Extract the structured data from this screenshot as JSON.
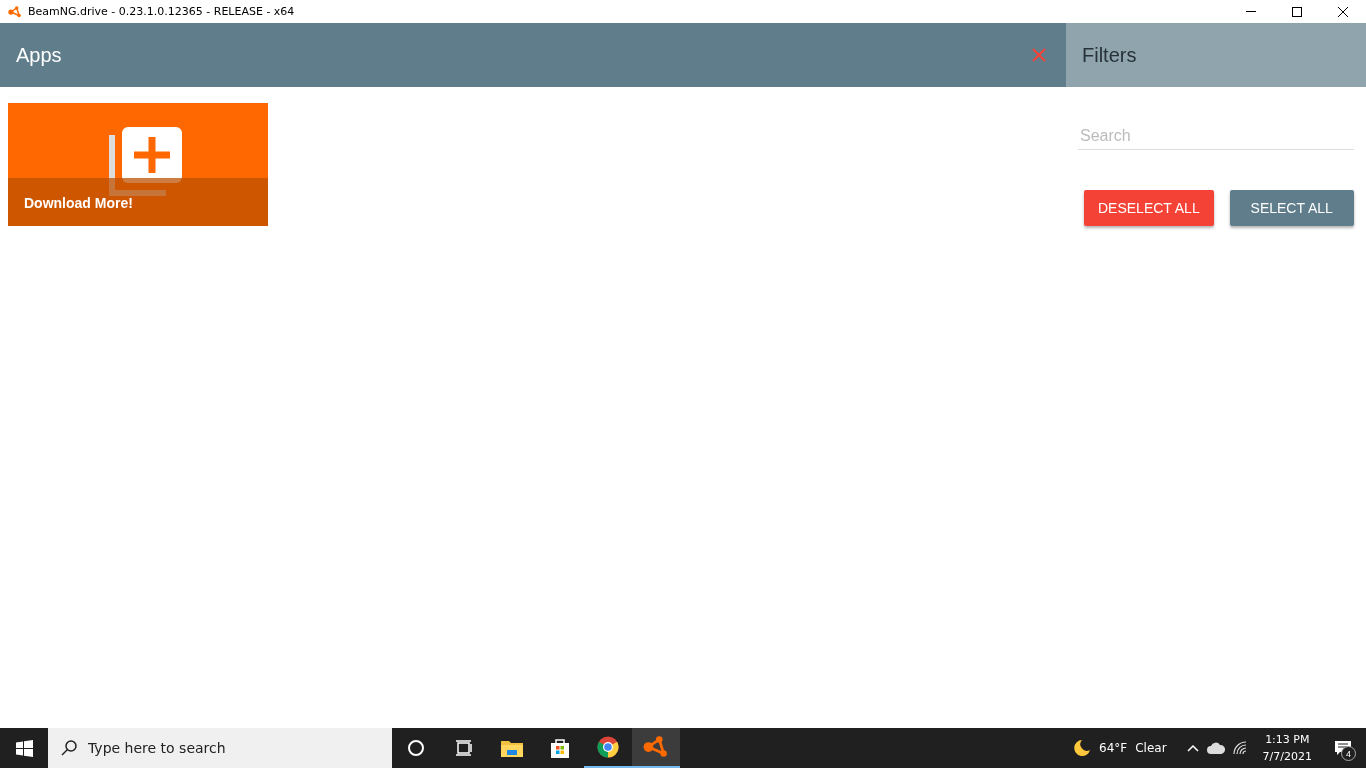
{
  "window": {
    "title": "BeamNG.drive - 0.23.1.0.12365 - RELEASE - x64"
  },
  "apps_panel": {
    "title": "Apps",
    "tiles": [
      {
        "label": "Download More!"
      }
    ]
  },
  "filters_panel": {
    "title": "Filters",
    "search": {
      "placeholder": "Search"
    },
    "buttons": [
      {
        "label": "DESELECT ALL",
        "kind": "danger"
      },
      {
        "label": "SELECT ALL",
        "kind": "primary"
      }
    ]
  },
  "taskbar": {
    "search": {
      "placeholder": "Type here to search"
    },
    "apps": [
      {
        "kind": "cortana",
        "running": false,
        "active": false
      },
      {
        "kind": "taskview",
        "running": false,
        "active": false
      },
      {
        "kind": "explorer",
        "running": false,
        "active": false
      },
      {
        "kind": "store",
        "running": false,
        "active": false
      },
      {
        "kind": "chrome",
        "running": true,
        "active": false
      },
      {
        "kind": "beamng",
        "running": true,
        "active": true
      }
    ],
    "weather": {
      "temperature": "64°F",
      "condition": "Clear"
    },
    "time": "1:13 PM",
    "date": "7/7/2021",
    "notifications": "4"
  }
}
